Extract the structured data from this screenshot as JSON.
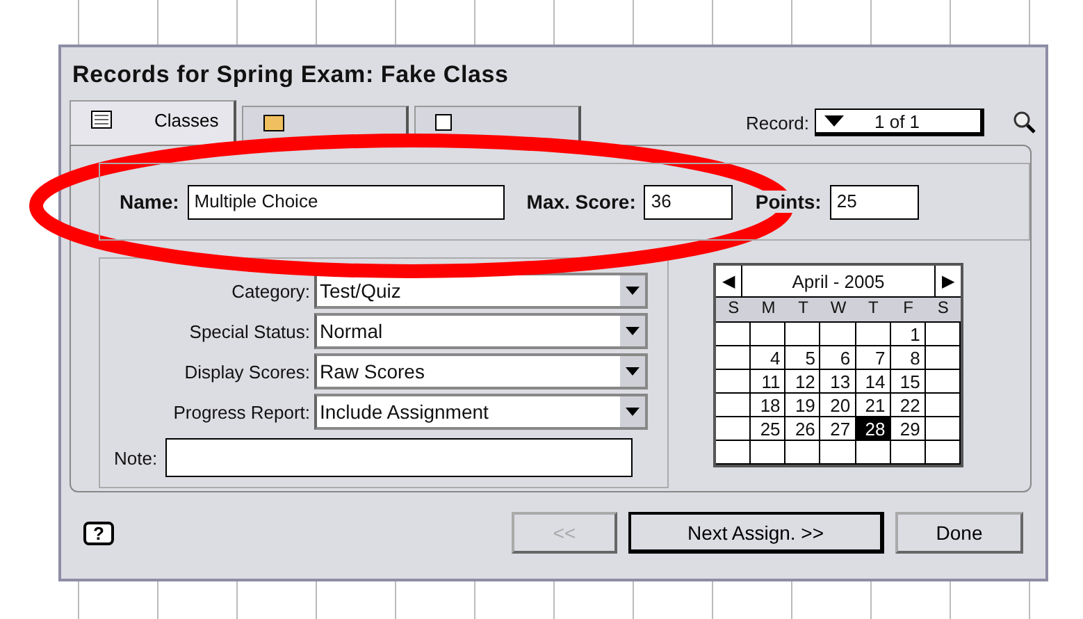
{
  "window": {
    "title": "Records for Spring Exam: Fake Class"
  },
  "tabs": [
    {
      "label": "Classes",
      "selected": true
    },
    {
      "selected": false
    },
    {
      "selected": false
    }
  ],
  "record": {
    "label": "Record:",
    "value": "1 of 1"
  },
  "fields": [
    {
      "label": "Name:",
      "value": "Multiple Choice",
      "kind": "wide"
    },
    {
      "label": "Max. Score:",
      "value": "36",
      "kind": "short"
    },
    {
      "label": "Points:",
      "value": "25",
      "kind": "short"
    }
  ],
  "options": [
    {
      "label": "Category:",
      "value": "Test/Quiz"
    },
    {
      "label": "Special Status:",
      "value": "Normal"
    },
    {
      "label": "Display Scores:",
      "value": "Raw Scores"
    },
    {
      "label": "Progress Report:",
      "value": "Include Assignment"
    }
  ],
  "note": {
    "label": "Note:"
  },
  "calendar": {
    "month": "April - 2005",
    "prev": "◀",
    "next": "▶",
    "weekdays": [
      "S",
      "M",
      "T",
      "W",
      "T",
      "F",
      "S"
    ],
    "weeks": [
      [
        {
          "kind": "blank"
        },
        {
          "kind": "blank"
        },
        {
          "kind": "blank"
        },
        {
          "kind": "blank"
        },
        {
          "kind": "blank"
        },
        {
          "kind": "day",
          "day": "1",
          "selected": false
        },
        {
          "kind": "blank"
        }
      ],
      [
        {
          "kind": "blank"
        },
        {
          "kind": "day",
          "day": "4",
          "selected": false
        },
        {
          "kind": "day",
          "day": "5",
          "selected": false
        },
        {
          "kind": "day",
          "day": "6",
          "selected": false
        },
        {
          "kind": "day",
          "day": "7",
          "selected": false
        },
        {
          "kind": "day",
          "day": "8",
          "selected": false
        },
        {
          "kind": "blank"
        }
      ],
      [
        {
          "kind": "blank"
        },
        {
          "kind": "day",
          "day": "11",
          "selected": false
        },
        {
          "kind": "day",
          "day": "12",
          "selected": false
        },
        {
          "kind": "day",
          "day": "13",
          "selected": false
        },
        {
          "kind": "day",
          "day": "14",
          "selected": false
        },
        {
          "kind": "day",
          "day": "15",
          "selected": false
        },
        {
          "kind": "blank"
        }
      ],
      [
        {
          "kind": "blank"
        },
        {
          "kind": "day",
          "day": "18",
          "selected": false
        },
        {
          "kind": "day",
          "day": "19",
          "selected": false
        },
        {
          "kind": "day",
          "day": "20",
          "selected": false
        },
        {
          "kind": "day",
          "day": "21",
          "selected": false
        },
        {
          "kind": "day",
          "day": "22",
          "selected": false
        },
        {
          "kind": "blank"
        }
      ],
      [
        {
          "kind": "blank"
        },
        {
          "kind": "day",
          "day": "25",
          "selected": false
        },
        {
          "kind": "day",
          "day": "26",
          "selected": false
        },
        {
          "kind": "day",
          "day": "27",
          "selected": false
        },
        {
          "kind": "day",
          "day": "28",
          "selected": true
        },
        {
          "kind": "day",
          "day": "29",
          "selected": false
        },
        {
          "kind": "blank"
        }
      ],
      [
        {
          "kind": "blank"
        },
        {
          "kind": "blank"
        },
        {
          "kind": "blank"
        },
        {
          "kind": "blank"
        },
        {
          "kind": "blank"
        },
        {
          "kind": "blank"
        },
        {
          "kind": "blank"
        }
      ]
    ]
  },
  "help": {
    "label": "?"
  },
  "buttons": [
    {
      "label": "<<",
      "disabled": true,
      "default": false
    },
    {
      "label": "Next Assign. >>",
      "disabled": false,
      "default": true
    },
    {
      "label": "Done",
      "disabled": false,
      "default": false
    }
  ]
}
